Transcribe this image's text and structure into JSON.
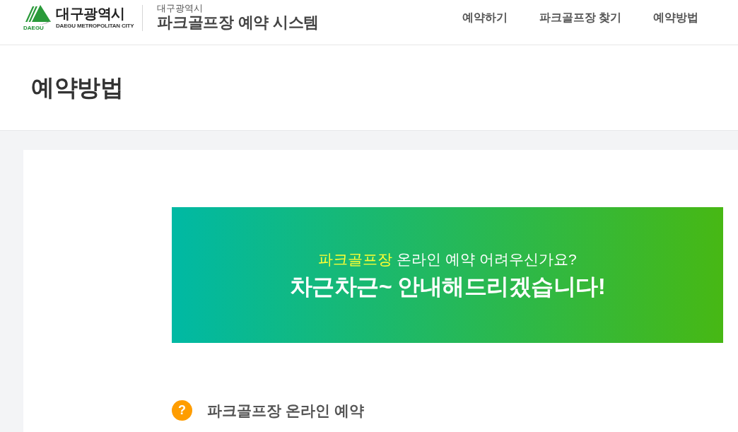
{
  "header": {
    "logo": {
      "emblem_text": "DAEGU",
      "name": "대구광역시",
      "english_name": "DAEGU METROPOLITAN CITY"
    },
    "site": {
      "subtitle": "대구광역시",
      "title": "파크골프장 예약 시스템"
    },
    "nav": [
      "예약하기",
      "파크골프장 찾기",
      "예약방법"
    ]
  },
  "page_title": "예약방법",
  "banner": {
    "question": [
      {
        "text": "파크골프장",
        "highlight": true
      },
      {
        "text": "온라인 예약 어려우신가요?",
        "highlight": false
      }
    ],
    "headline": "차근차근~ 안내해드리겠습니다!"
  },
  "section": {
    "icon_text": "?",
    "title": "파크골프장 온라인 예약"
  }
}
